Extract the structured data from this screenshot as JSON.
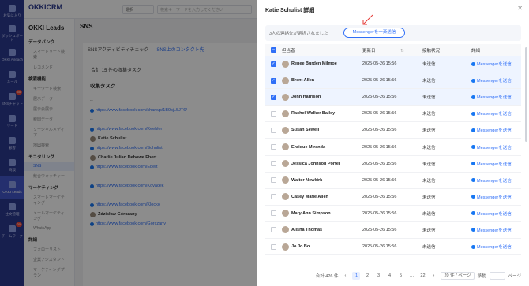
{
  "app": {
    "logo": "OKKICRM"
  },
  "nav": [
    {
      "label": "お気に入り",
      "icon": "star-icon"
    },
    {
      "label": "ダッシュボード",
      "icon": "dashboard-icon"
    },
    {
      "label": "OKKI Aireach",
      "icon": "ai-icon"
    },
    {
      "label": "メール",
      "icon": "mail-icon"
    },
    {
      "label": "SNSチャット",
      "icon": "chat-icon",
      "badge": "55"
    },
    {
      "label": "リード",
      "icon": "lead-icon"
    },
    {
      "label": "顧客",
      "icon": "customer-icon"
    },
    {
      "label": "商談",
      "icon": "deal-icon"
    },
    {
      "label": "OKKI Leads",
      "icon": "leads-icon",
      "active": true
    },
    {
      "label": "注文管理",
      "icon": "order-icon"
    },
    {
      "label": "チームワーク",
      "icon": "team-icon",
      "badge": "20"
    }
  ],
  "topbar": {
    "select": "選択",
    "search_placeholder": "検索キーワードを入力してください"
  },
  "sidemenu": {
    "title": "OKKI Leads",
    "groups": [
      {
        "label": "データバンク",
        "items": [
          "スマートリード検索",
          "レコメンド"
        ]
      },
      {
        "label": "検索機能",
        "items": [
          "キーワード検索",
          "展示データ",
          "展示会展示",
          "税関データ",
          "ソーシャルメディア",
          "地図検索"
        ]
      },
      {
        "label": "モニタリング",
        "items": [
          "SNS",
          "競合ウォッチャー"
        ]
      },
      {
        "label": "マーケティング",
        "items": [
          "スマートマーケティング",
          "メールマーケティング",
          "WhatsApp"
        ]
      },
      {
        "label": "詳細",
        "items": [
          "フォローリスト",
          "企業アシスタント",
          "マーケティングプラン"
        ]
      }
    ],
    "active_item": "SNS"
  },
  "center": {
    "title": "SNS",
    "tabs": [
      "SNSアクティビティチェック",
      "SNS上のコンタクト先"
    ],
    "total": "合計 15 件の収集タスク",
    "subtitle": "収集タスク",
    "feed": [
      {
        "text": "--"
      },
      {
        "link": "https://www.facebook.com/share/p/1B9cjL5JT6/"
      },
      {
        "text": "--"
      },
      {
        "link": "https://www.facebook.com/Keebler"
      },
      {
        "name": "Katie Schulist"
      },
      {
        "link": "https://www.facebook.com/Schulist"
      },
      {
        "name": "Charlie Julian Debowe Ebert"
      },
      {
        "link": "https://www.facebook.com/Ebert"
      },
      {
        "text": "--"
      },
      {
        "link": "https://www.facebook.com/Kovacek"
      },
      {
        "text": "--"
      },
      {
        "link": "https://www.facebook.com/Klocko"
      },
      {
        "name": "Zdzisław Górczany"
      },
      {
        "link": "https://www.facebook.com/Gorczany"
      }
    ]
  },
  "drawer": {
    "title": "Katie Schulist 詳細",
    "selected_text": "3人の連絡先が選択されました",
    "bulk_button": "Messengerを一斉送信",
    "columns": [
      "担当者",
      "更新日",
      "接触状況",
      "詳細"
    ],
    "rows": [
      {
        "name": "Renee Burden Milmoe",
        "date": "2025-05-26 15:56",
        "status": "未送信",
        "action": "Messengerを送信",
        "checked": true
      },
      {
        "name": "Brent Allen",
        "date": "2025-05-26 15:56",
        "status": "未送信",
        "action": "Messengerを送信",
        "checked": true
      },
      {
        "name": "John Harrison",
        "date": "2025-05-26 15:56",
        "status": "未送信",
        "action": "Messengerを送信",
        "checked": true
      },
      {
        "name": "Rachel Walker Bailey",
        "date": "2025-05-26 15:56",
        "status": "未送信",
        "action": "Messengerを送信",
        "checked": false
      },
      {
        "name": "Susan Sewell",
        "date": "2025-05-26 15:56",
        "status": "未送信",
        "action": "Messengerを送信",
        "checked": false
      },
      {
        "name": "Enrique Miranda",
        "date": "2025-05-26 15:56",
        "status": "未送信",
        "action": "Messengerを送信",
        "checked": false
      },
      {
        "name": "Jessica Johnson Porter",
        "date": "2025-05-26 15:56",
        "status": "未送信",
        "action": "Messengerを送信",
        "checked": false
      },
      {
        "name": "Walter Newkirk",
        "date": "2025-05-26 15:56",
        "status": "未送信",
        "action": "Messengerを送信",
        "checked": false
      },
      {
        "name": "Casey Marie Allen",
        "date": "2025-05-26 15:56",
        "status": "未送信",
        "action": "Messengerを送信",
        "checked": false
      },
      {
        "name": "Mary Ann Simpson",
        "date": "2025-05-26 15:56",
        "status": "未送信",
        "action": "Messengerを送信",
        "checked": false
      },
      {
        "name": "Alisha Thomas",
        "date": "2025-05-26 15:56",
        "status": "未送信",
        "action": "Messengerを送信",
        "checked": false
      },
      {
        "name": "Jo Jo Bo",
        "date": "2025-05-26 15:56",
        "status": "未送信",
        "action": "Messengerを送信",
        "checked": false
      }
    ],
    "pager": {
      "total": "合計 426 件",
      "pages": [
        "1",
        "2",
        "3",
        "4",
        "5",
        "…",
        "22"
      ],
      "active_page": "1",
      "page_size": "20 件 / ページ",
      "jump_label": "移動",
      "jump_suffix": "ページ"
    }
  },
  "colors": {
    "primary": "#2f6ff7",
    "nav_bg": "#2b3a8f",
    "facebook": "#1877f2",
    "annotation": "#e53935"
  }
}
